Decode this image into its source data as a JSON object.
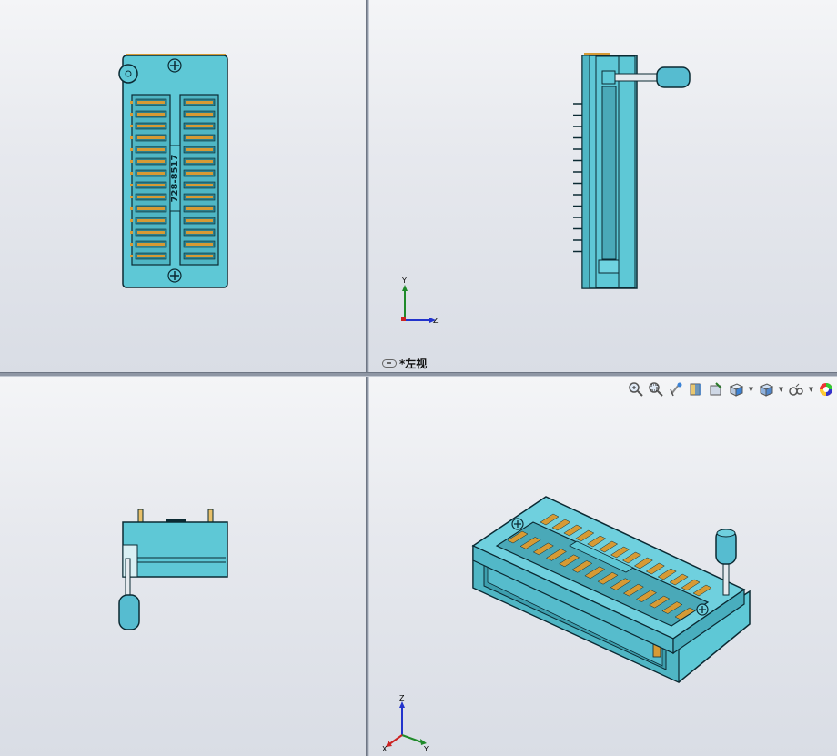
{
  "viewports": {
    "top_left": {
      "name": "front-view"
    },
    "top_right": {
      "name": "left-view",
      "label": "*左视",
      "axes": {
        "y": "Y",
        "z": "Z"
      }
    },
    "bottom_left": {
      "name": "top-view"
    },
    "bottom_right": {
      "name": "isometric-view",
      "axes": {
        "z": "Z",
        "x": "X",
        "y": "Y"
      }
    }
  },
  "part": {
    "marking": "728-8517",
    "colors": {
      "body": "#5ec8d6",
      "outline": "#0b2a33",
      "contact": "#d69a34",
      "handle": "#56bcd0"
    }
  },
  "heads_up_toolbar": [
    {
      "icon": "zoom-to-fit-icon"
    },
    {
      "icon": "zoom-to-area-icon"
    },
    {
      "icon": "previous-view-icon"
    },
    {
      "icon": "section-view-icon"
    },
    {
      "icon": "dynamic-annotation-icon"
    },
    {
      "icon": "view-orientation-icon",
      "dropdown": true
    },
    {
      "icon": "display-style-icon",
      "dropdown": true
    },
    {
      "icon": "hide-show-items-icon",
      "dropdown": true
    },
    {
      "icon": "appearance-icon"
    }
  ]
}
